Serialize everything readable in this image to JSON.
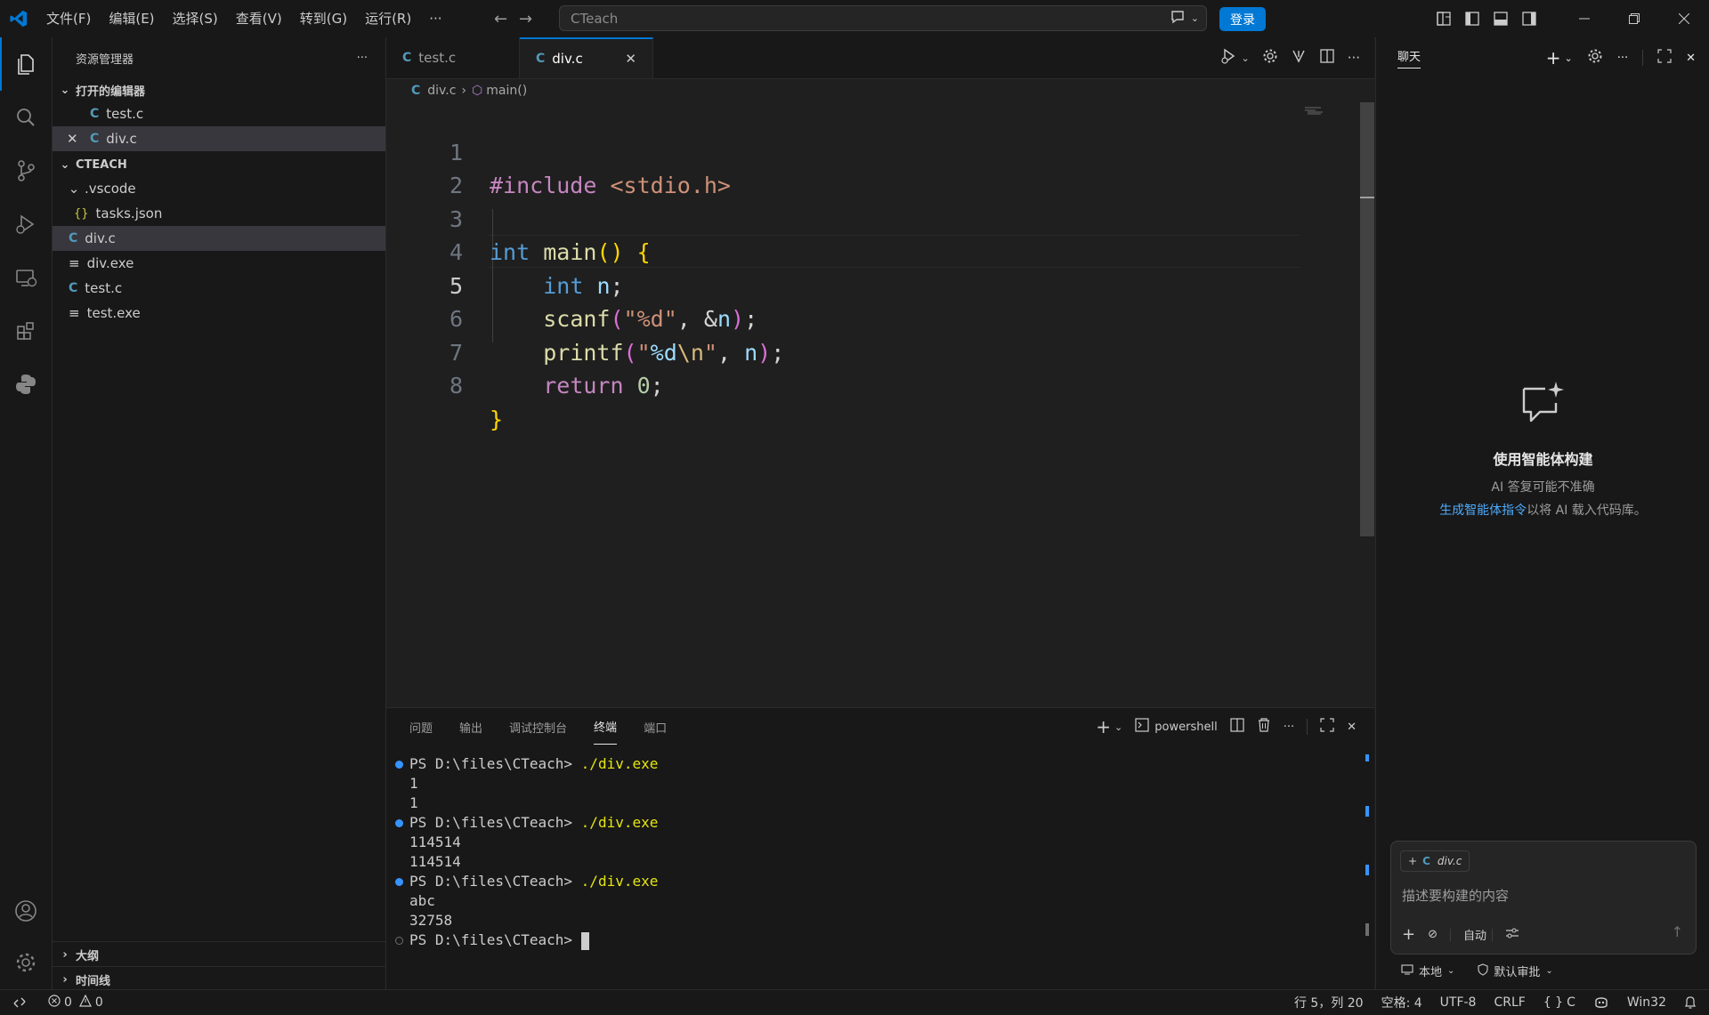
{
  "titlebar": {
    "menus": [
      "文件(F)",
      "编辑(E)",
      "选择(S)",
      "查看(V)",
      "转到(G)",
      "运行(R)",
      "···"
    ],
    "search_text": "CTeach",
    "login_label": "登录"
  },
  "sidebar": {
    "title": "资源管理器",
    "open_editors_title": "打开的编辑器",
    "open_editors": [
      {
        "label": "test.c"
      },
      {
        "label": "div.c"
      }
    ],
    "project_title": "CTEACH",
    "folder_vscode": ".vscode",
    "tasks_json": "tasks.json",
    "files": [
      "div.c",
      "div.exe",
      "test.c",
      "test.exe"
    ],
    "outline_title": "大纲",
    "timeline_title": "时间线"
  },
  "editor": {
    "tabs": [
      "test.c",
      "div.c"
    ],
    "breadcrumb_file": "div.c",
    "breadcrumb_symbol": "main()",
    "line_numbers": [
      "1",
      "2",
      "3",
      "4",
      "5",
      "6",
      "7",
      "8"
    ]
  },
  "panel": {
    "tabs": [
      "问题",
      "输出",
      "调试控制台",
      "终端",
      "端口"
    ],
    "shell_name": "powershell",
    "prompt": "PS D:\\files\\CTeach>",
    "command": "./div.exe",
    "outputs": [
      [
        "1",
        "1"
      ],
      [
        "114514",
        "114514"
      ],
      [
        "abc",
        "32758"
      ]
    ]
  },
  "chat": {
    "title": "聊天",
    "empty_heading": "使用智能体构建",
    "empty_sub": "AI 答复可能不准确",
    "link_text": "生成智能体指令",
    "link_suffix": "以将 AI 载入代码库。",
    "context_file": "div.c",
    "input_placeholder": "描述要构建的内容",
    "mode_label": "自动",
    "local_label": "本地",
    "approval_label": "默认审批"
  },
  "statusbar": {
    "errors": "0",
    "warnings": "0",
    "position": "行 5，列 20",
    "spaces": "空格: 4",
    "encoding": "UTF-8",
    "eol": "CRLF",
    "language": "C",
    "platform": "Win32"
  },
  "colors": {
    "accent": "#0078d4",
    "c_file_icon": "#519aba",
    "json_icon": "#cbcb41"
  }
}
